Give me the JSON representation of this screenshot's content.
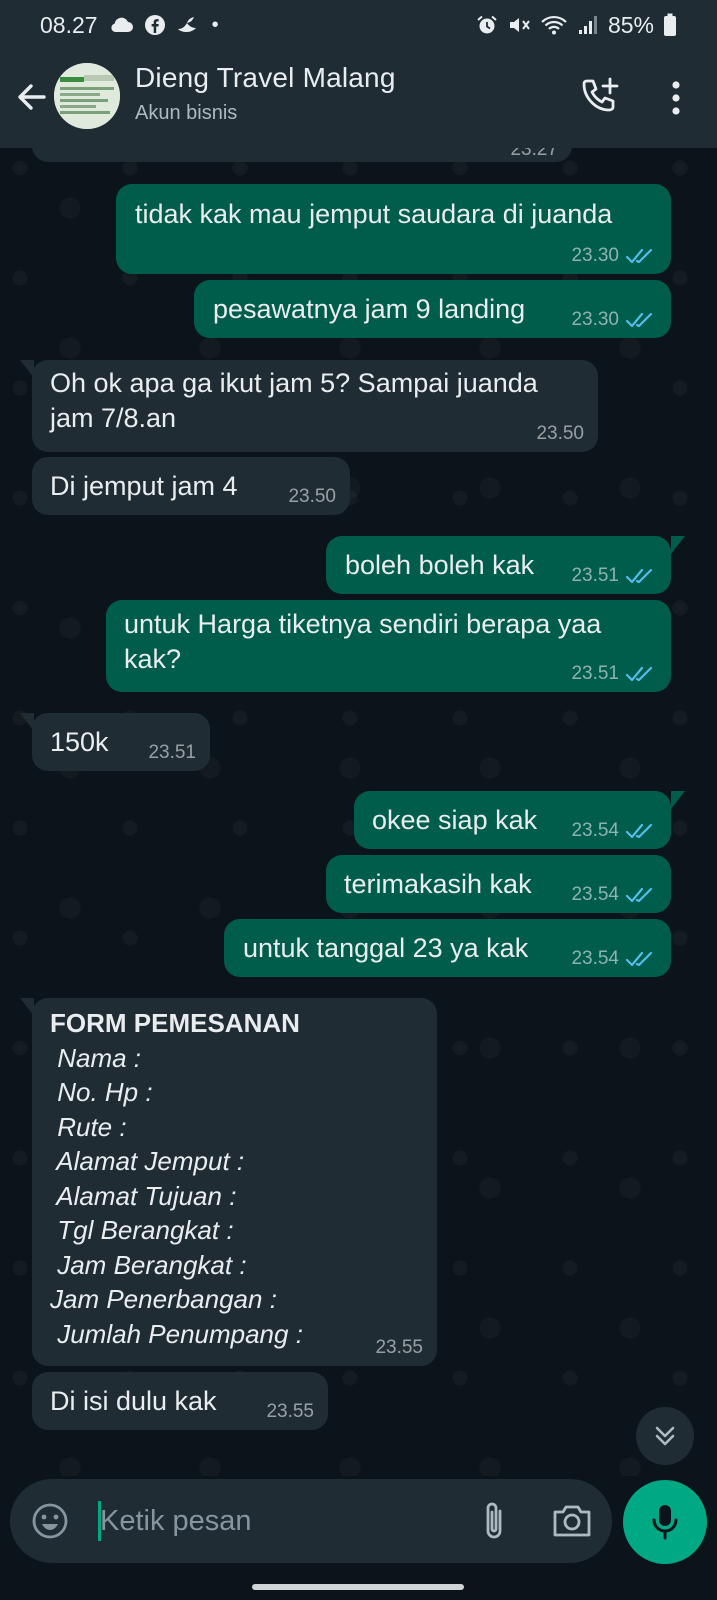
{
  "status_bar": {
    "time": "08.27",
    "dot": "•",
    "battery": "85%",
    "icons": [
      "cloud-icon",
      "facebook-icon",
      "bird-icon",
      "alarm-icon",
      "mute-icon",
      "wifi-icon",
      "signal-icon",
      "battery-icon"
    ]
  },
  "header": {
    "title": "Dieng Travel Malang",
    "subtitle": "Akun bisnis",
    "icons": [
      "back-arrow-icon",
      "add-call-icon",
      "more-vert-icon"
    ]
  },
  "messages": [
    {
      "id": "m0",
      "direction": "in",
      "text": "",
      "time": "23.27"
    },
    {
      "id": "m1",
      "direction": "out",
      "text": "tidak kak mau jemput saudara di juanda",
      "time": "23.30",
      "status": "read"
    },
    {
      "id": "m2",
      "direction": "out",
      "text": "pesawatnya jam 9 landing",
      "time": "23.30",
      "status": "read"
    },
    {
      "id": "m3",
      "direction": "in",
      "text": "Oh ok apa ga ikut jam 5? Sampai juanda\njam 7/8.an",
      "time": "23.50"
    },
    {
      "id": "m4",
      "direction": "in",
      "text": "Di jemput jam 4",
      "time": "23.50"
    },
    {
      "id": "m5",
      "direction": "out",
      "text": "boleh boleh kak",
      "time": "23.51",
      "status": "read"
    },
    {
      "id": "m6",
      "direction": "out",
      "text": "untuk Harga tiketnya sendiri berapa yaa\nkak?",
      "time": "23.51",
      "status": "read"
    },
    {
      "id": "m7",
      "direction": "in",
      "text": "150k",
      "time": "23.51"
    },
    {
      "id": "m8",
      "direction": "out",
      "text": "okee siap kak",
      "time": "23.54",
      "status": "read"
    },
    {
      "id": "m9",
      "direction": "out",
      "text": "terimakasih kak",
      "time": "23.54",
      "status": "read"
    },
    {
      "id": "m10",
      "direction": "out",
      "text": "untuk tanggal 23 ya kak",
      "time": "23.54",
      "status": "read"
    },
    {
      "id": "m11",
      "direction": "in",
      "title": "FORM PEMESANAN",
      "fields": [
        " Nama :",
        " No. Hp :",
        " Rute :",
        " Alamat Jemput :",
        " Alamat Tujuan :",
        " Tgl Berangkat :",
        " Jam Berangkat :",
        "Jam Penerbangan :",
        " Jumlah Penumpang :"
      ],
      "time": "23.55"
    },
    {
      "id": "m12",
      "direction": "in",
      "text": "Di isi dulu kak",
      "time": "23.55"
    }
  ],
  "input": {
    "placeholder": "Ketik pesan",
    "icons": [
      "emoji-icon",
      "attach-icon",
      "camera-icon",
      "mic-icon",
      "scroll-down-icon"
    ]
  },
  "colors": {
    "background": "#0b141a",
    "header": "#1f2c34",
    "outgoing_bubble": "#005c4b",
    "incoming_bubble": "#202c33",
    "accent": "#00a884",
    "read_ticks": "#53bdeb"
  }
}
